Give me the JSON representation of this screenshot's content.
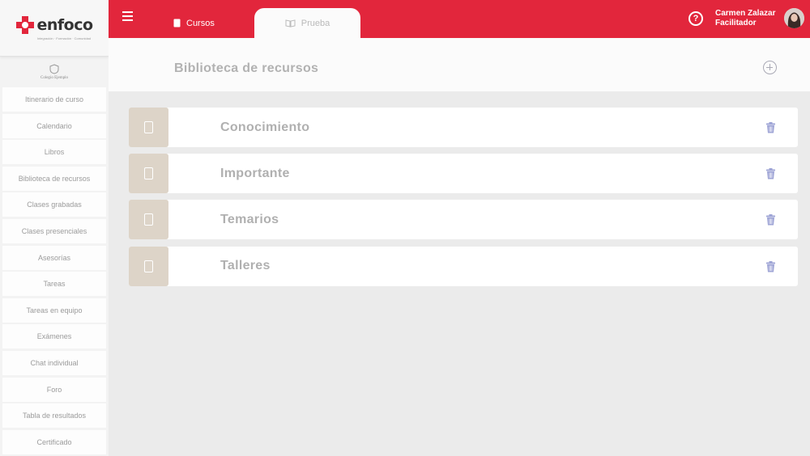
{
  "brand": {
    "name": "enfoco",
    "tagline": "Integración · Formación · Comunidad",
    "accent": "#e2263c"
  },
  "school": {
    "name": "Colegio Ejemplo"
  },
  "sidebar": {
    "items": [
      {
        "label": "Itinerario de curso"
      },
      {
        "label": "Calendario"
      },
      {
        "label": "Libros"
      },
      {
        "label": "Biblioteca de recursos"
      },
      {
        "label": "Clases grabadas"
      },
      {
        "label": "Clases presenciales"
      },
      {
        "label": "Asesorías"
      },
      {
        "label": "Tareas"
      },
      {
        "label": "Tareas en equipo"
      },
      {
        "label": "Exámenes"
      },
      {
        "label": "Chat individual"
      },
      {
        "label": "Foro"
      },
      {
        "label": "Tabla de resultados"
      },
      {
        "label": "Certificado"
      }
    ]
  },
  "topbar": {
    "tabs": [
      {
        "label": "Cursos",
        "icon": "book-icon"
      },
      {
        "label": "Prueba",
        "icon": "open-book-icon"
      }
    ],
    "help_icon": "question-circle-icon",
    "user": {
      "name": "Carmen Zalazar",
      "role": "Facilitador"
    }
  },
  "main": {
    "title": "Biblioteca de recursos",
    "add_icon": "plus-circle-icon",
    "resources": [
      {
        "name": "Conocimiento"
      },
      {
        "name": "Importante"
      },
      {
        "name": "Temarios"
      },
      {
        "name": "Talleres"
      }
    ]
  }
}
